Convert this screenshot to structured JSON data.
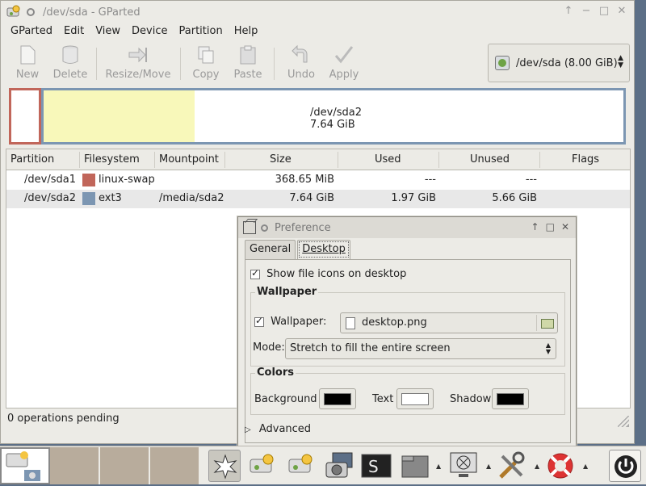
{
  "window": {
    "title": "/dev/sda - GParted",
    "controls": [
      "↑",
      "−",
      "□",
      "✕"
    ]
  },
  "menu": [
    "GParted",
    "Edit",
    "View",
    "Device",
    "Partition",
    "Help"
  ],
  "toolbar": {
    "new": "New",
    "delete": "Delete",
    "resize": "Resize/Move",
    "copy": "Copy",
    "paste": "Paste",
    "undo": "Undo",
    "apply": "Apply"
  },
  "device": {
    "label": "/dev/sda   (8.00 GiB)"
  },
  "partition_map": {
    "name": "/dev/sda2",
    "size": "7.64 GiB",
    "used_fraction": 0.26
  },
  "columns": [
    "Partition",
    "Filesystem",
    "Mountpoint",
    "Size",
    "Used",
    "Unused",
    "Flags"
  ],
  "rows": [
    {
      "partition": "/dev/sda1",
      "fs": "linux-swap",
      "fs_color": "#c1665a",
      "mount": "",
      "size": "368.65 MiB",
      "used": "---",
      "unused": "---",
      "flags": ""
    },
    {
      "partition": "/dev/sda2",
      "fs": "ext3",
      "fs_color": "#7c96b2",
      "mount": "/media/sda2",
      "size": "7.64 GiB",
      "used": "1.97 GiB",
      "unused": "5.66 GiB",
      "flags": ""
    }
  ],
  "status": "0 operations pending",
  "dialog": {
    "title": "Preference",
    "tabs": [
      "General",
      "Desktop"
    ],
    "show_icons": "Show file icons on desktop",
    "wallpaper_group": "Wallpaper",
    "wallpaper_label": "Wallpaper:",
    "wallpaper_file": "desktop.png",
    "mode_label": "Mode:",
    "mode_value": "Stretch to fill the entire screen",
    "colors_group": "Colors",
    "background_label": "Background",
    "background_color": "#000000",
    "text_label": "Text",
    "text_color": "#ffffff",
    "shadow_label": "Shadow",
    "shadow_color": "#000000",
    "advanced": "Advanced"
  }
}
